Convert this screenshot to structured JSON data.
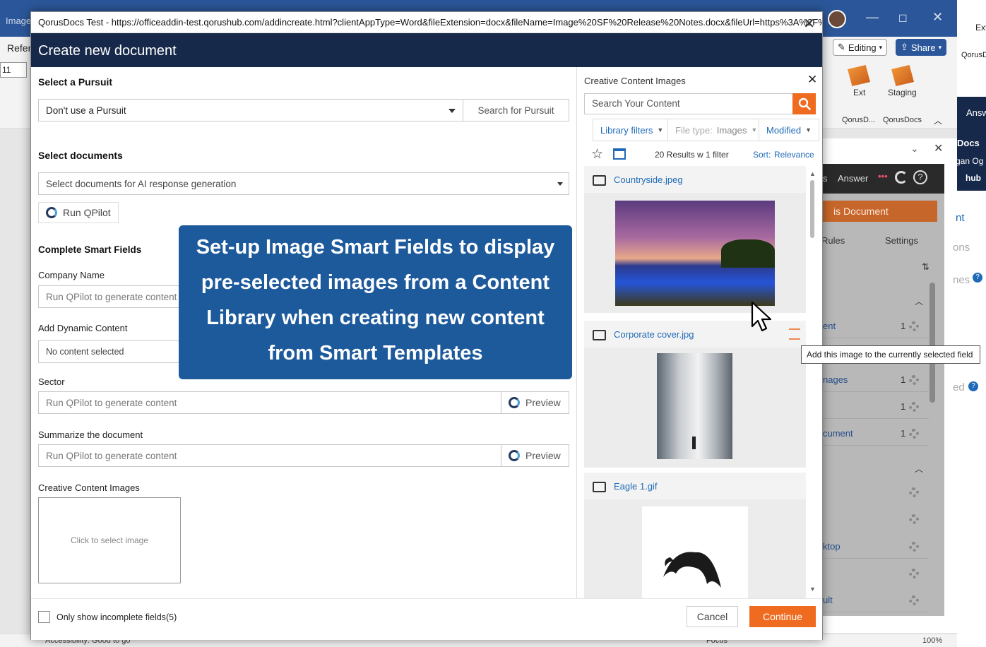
{
  "background": {
    "app_tab_fragment": "Image",
    "ribbon_tab_fragment": "Refer",
    "font_size_value": "11",
    "editing_label": "Editing",
    "share_label": "Share",
    "ext_label": "Ext",
    "staging_label": "Staging",
    "qorusd_label": "QorusD...",
    "qorusdocs_label": "QorusDocs",
    "right_edge_labels": [
      "Ext",
      "QorusD",
      "Answ",
      "Docs",
      "gan Og",
      "hub"
    ],
    "status_accessibility": "Accessibility: Good to go",
    "status_focus": "Focus",
    "status_zoom": "100%",
    "pane": {
      "nav_answer": "Answer",
      "nav_s": "s",
      "orange_button": "is Document",
      "tab_rules": "Rules",
      "tab_settings": "Settings",
      "rows": [
        {
          "label": "ent",
          "count": "1"
        },
        {
          "label": "nages",
          "count": "1"
        },
        {
          "label": "",
          "count": "1"
        },
        {
          "label": "cument",
          "count": "1"
        },
        {
          "label": "",
          "count": ""
        },
        {
          "label": "",
          "count": ""
        },
        {
          "label": "ktop",
          "count": ""
        },
        {
          "label": "",
          "count": ""
        },
        {
          "label": "ult",
          "count": ""
        }
      ],
      "side_fragments": [
        "nt",
        "ons",
        "nes",
        "ed"
      ]
    }
  },
  "dialog": {
    "title_bar": "QorusDocs Test - https://officeaddin-test.qorushub.com/addincreate.html?clientAppType=Word&fileExtension=docx&fileName=Image%20SF%20Release%20Notes.docx&fileUrl=https%3A%2F%2Fqddtt...",
    "header": "Create new document",
    "select_pursuit_heading": "Select a Pursuit",
    "pursuit_value": "Don't use a Pursuit",
    "search_pursuit_button": "Search for Pursuit",
    "select_documents_heading": "Select documents",
    "documents_placeholder": "Select documents for AI response generation",
    "run_qpilot_button": "Run QPilot",
    "smart_fields_heading": "Complete Smart Fields",
    "fields": {
      "company_name_label": "Company Name",
      "company_name_placeholder": "Run QPilot to generate content",
      "dynamic_content_label": "Add Dynamic Content",
      "dynamic_content_value": "No content selected",
      "sector_label": "Sector",
      "sector_placeholder": "Run QPilot to generate content",
      "summarize_label": "Summarize the document",
      "summarize_placeholder": "Run QPilot to generate content",
      "preview_label": "Preview",
      "images_label": "Creative Content Images",
      "image_placeholder": "Click to select image"
    },
    "overlay_callout": [
      "Set-up Image Smart Fields to display",
      "pre-selected images from a Content",
      "Library when creating new content",
      "from Smart Templates"
    ],
    "footer": {
      "only_incomplete_label": "Only show incomplete fields",
      "incomplete_count": "(5)",
      "cancel": "Cancel",
      "continue": "Continue"
    },
    "image_panel": {
      "title": "Creative Content Images",
      "search_placeholder": "Search Your Content",
      "library_filters": "Library filters",
      "file_type_prefix": "File type:",
      "file_type_value": "Images",
      "modified": "Modified",
      "results": "20 Results w 1 filter",
      "sort_label": "Sort:",
      "sort_value": "Relevance",
      "items": [
        {
          "name": "Countryside.jpeg"
        },
        {
          "name": "Corporate cover.jpg"
        },
        {
          "name": "Eagle 1.gif"
        }
      ],
      "tooltip": "Add this image to the currently selected field"
    }
  },
  "colors": {
    "header_navy": "#17294a",
    "accent_orange": "#ee6b1f",
    "link_blue": "#1f6ab8",
    "callout_blue": "#1d5a9c"
  }
}
